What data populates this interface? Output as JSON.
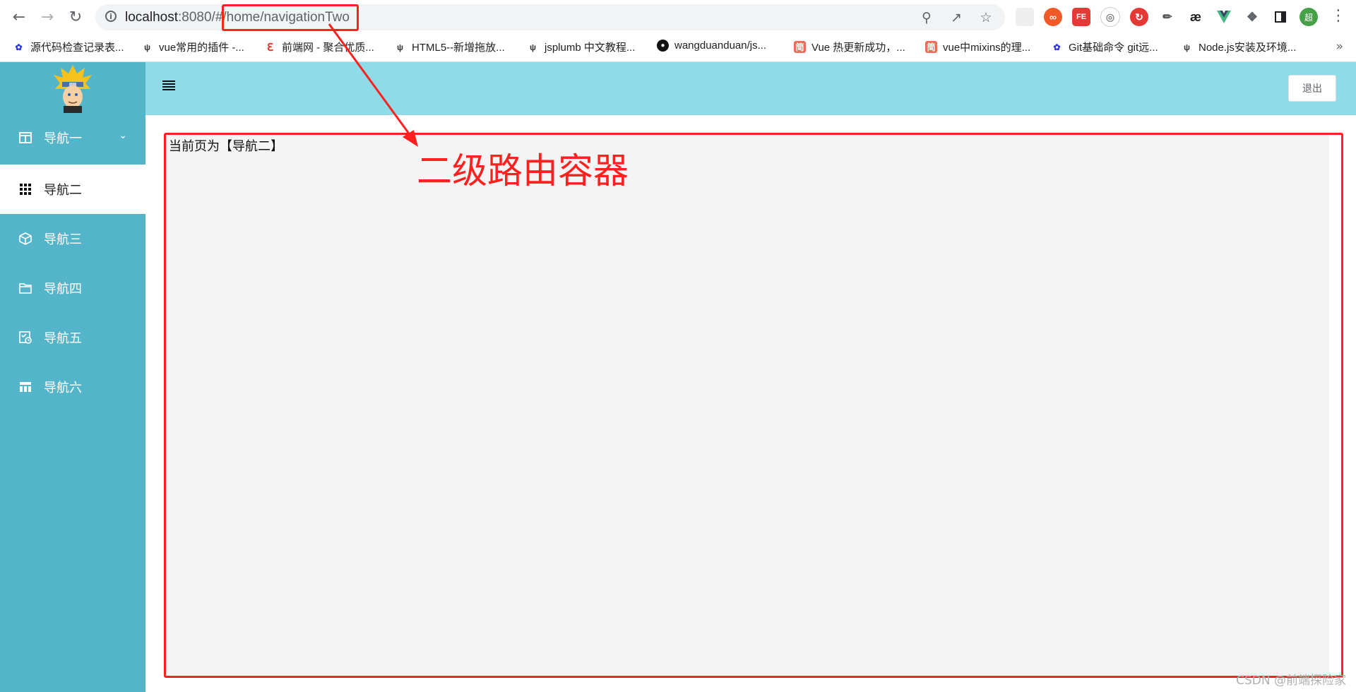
{
  "browser": {
    "url": {
      "host": "localhost",
      "port": ":8080/#",
      "path": "/home/navigationTwo"
    },
    "profile_initial": "超",
    "extensions": [
      "∞",
      "FE",
      "æ"
    ],
    "bookmarks": [
      {
        "label": "源代码检查记录表...",
        "icon": "baidu-paw-icon"
      },
      {
        "label": "vue常用的插件 -...",
        "icon": "yuque-icon"
      },
      {
        "label": "前端网 - 聚合优质...",
        "icon": "qianduan-icon"
      },
      {
        "label": "HTML5--新增拖放...",
        "icon": "yuque-icon"
      },
      {
        "label": "jsplumb 中文教程...",
        "icon": "yuque-icon"
      },
      {
        "label": "wangduanduan/js...",
        "icon": "github-icon"
      },
      {
        "label": "Vue 热更新成功，...",
        "icon": "jianshu-icon",
        "icon_text": "简"
      },
      {
        "label": "vue中mixins的理...",
        "icon": "jianshu-icon",
        "icon_text": "简"
      },
      {
        "label": "Git基础命令 git远...",
        "icon": "baidu-paw-icon"
      },
      {
        "label": "Node.js安装及环境...",
        "icon": "yuque-icon"
      }
    ],
    "bookmarks_more": "»"
  },
  "sidebar": {
    "items": [
      {
        "label": "导航一",
        "icon": "calendar-icon",
        "has_submenu": true
      },
      {
        "label": "导航二",
        "icon": "grid-icon",
        "active": true
      },
      {
        "label": "导航三",
        "icon": "cube-icon"
      },
      {
        "label": "导航四",
        "icon": "folder-icon"
      },
      {
        "label": "导航五",
        "icon": "schedule-icon"
      },
      {
        "label": "导航六",
        "icon": "table-icon"
      }
    ]
  },
  "header": {
    "logout_label": "退出"
  },
  "content": {
    "text": "当前页为【导航二】"
  },
  "annotation": {
    "label": "二级路由容器",
    "color": "#ff2020"
  },
  "watermark": "CSDN @前端探险家",
  "colors": {
    "sidebar": "#54b4c9",
    "header": "#8fdbe8",
    "content_bg": "#f4f4f4"
  }
}
